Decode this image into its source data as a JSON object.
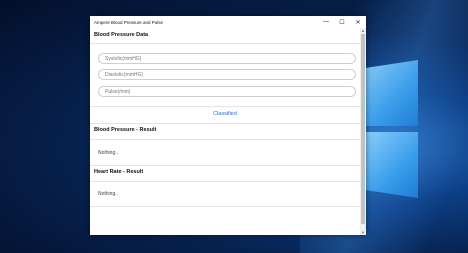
{
  "window": {
    "title": "Ampere Blood Pressure and Pulse",
    "controls": {
      "minimize": "—",
      "maximize": "☐",
      "close": "✕"
    }
  },
  "blood_pressure_data": {
    "header": "Blood Pressure Data",
    "systolic_placeholder": "Systolic(mmHG)",
    "diastolic_placeholder": "Diastolic(mmHG)",
    "pulse_placeholder": "Pulse(/min)"
  },
  "classified_label": "Classified",
  "blood_pressure_result": {
    "header": "Blood Pressure - Result",
    "value": "Nothing.."
  },
  "heart_rate_result": {
    "header": "Heart Rate - Result",
    "value": "Nothing.."
  },
  "colors": {
    "accent": "#2a6fc9",
    "desktop": "#0d3f86"
  }
}
